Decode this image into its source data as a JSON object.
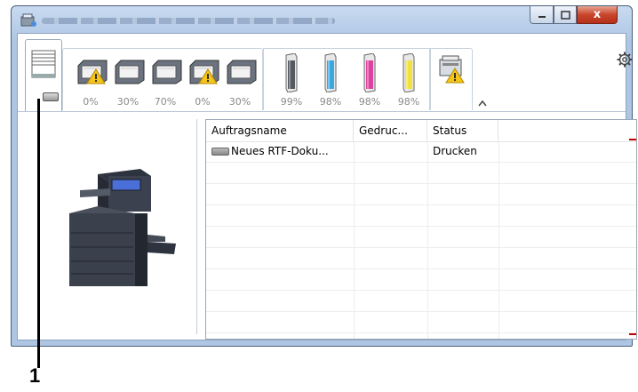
{
  "window": {
    "title_obscured": true,
    "buttons": {
      "minimize": "minimize-icon",
      "maximize": "maximize-icon",
      "close": "x"
    }
  },
  "toolbar": {
    "paper_trays": [
      {
        "level": "0%",
        "warning": true
      },
      {
        "level": "30%",
        "warning": false
      },
      {
        "level": "70%",
        "warning": false
      },
      {
        "level": "0%",
        "warning": true
      },
      {
        "level": "30%",
        "warning": false
      }
    ],
    "toners": [
      {
        "color": "black",
        "hex": "#555a62",
        "level": "99%"
      },
      {
        "color": "cyan",
        "hex": "#3aa8e0",
        "level": "98%"
      },
      {
        "color": "magenta",
        "hex": "#e040a0",
        "level": "98%"
      },
      {
        "color": "yellow",
        "hex": "#f0e040",
        "level": "98%"
      }
    ],
    "device_warning": true,
    "collapse_icon": "chevron-up-icon",
    "settings_icon": "gear-icon"
  },
  "job_list": {
    "columns": [
      "Auftragsname",
      "Gedruc...",
      "Status"
    ],
    "rows": [
      {
        "name": "Neues RTF-Doku...",
        "printed": "",
        "status": "Drucken"
      }
    ]
  },
  "callout": {
    "number": "1"
  },
  "colors": {
    "warning": "#f5c518",
    "marker": "#c00000",
    "window_frame": "#aec6e4"
  }
}
